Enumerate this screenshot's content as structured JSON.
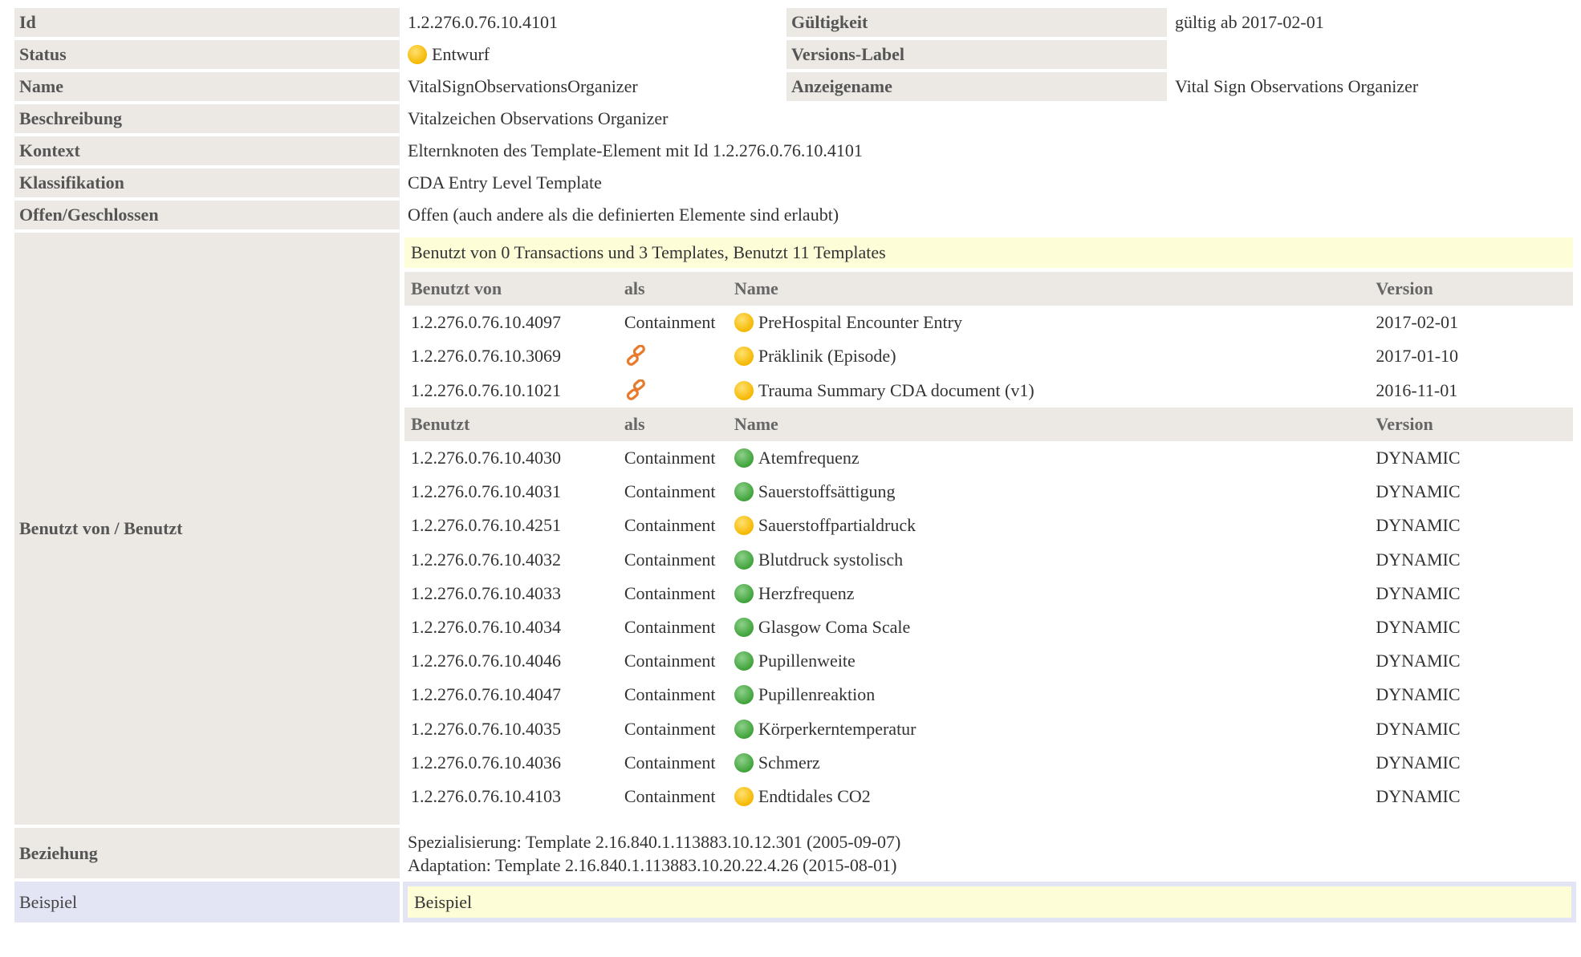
{
  "rows": {
    "id": {
      "label": "Id",
      "value": "1.2.276.0.76.10.4101"
    },
    "gueltigkeit": {
      "label": "Gültigkeit",
      "value": "gültig ab 2017-02-01"
    },
    "status": {
      "label": "Status",
      "value": "Entwurf",
      "icon": "status-draft-icon"
    },
    "version_label": {
      "label": "Versions-Label",
      "value": ""
    },
    "name": {
      "label": "Name",
      "value": "VitalSignObservationsOrganizer"
    },
    "anzeigename": {
      "label": "Anzeigename",
      "value": "Vital Sign Observations Organizer"
    },
    "beschreibung": {
      "label": "Beschreibung",
      "value": "Vitalzeichen Observations Organizer"
    },
    "kontext": {
      "label": "Kontext",
      "value": "Elternknoten des Template-Element mit Id 1.2.276.0.76.10.4101"
    },
    "klassifikation": {
      "label": "Klassifikation",
      "value": "CDA Entry Level Template"
    },
    "offen": {
      "label": "Offen/Geschlossen",
      "value": "Offen (auch andere als die definierten Elemente sind erlaubt)"
    },
    "benutzt_von_benutzt": {
      "label": "Benutzt von / Benutzt"
    },
    "beziehung": {
      "label": "Beziehung",
      "line1": "Spezialisierung: Template 2.16.840.1.113883.10.12.301 (2005-09-07)",
      "line2": "Adaptation: Template 2.16.840.1.113883.10.20.22.4.26 (2015-08-01)"
    },
    "beispiel": {
      "label": "Beispiel",
      "value": "Beispiel"
    }
  },
  "usage": {
    "summary": "Benutzt von 0 Transactions und 3 Templates, Benutzt 11 Templates",
    "used_by_header": {
      "col1": "Benutzt von",
      "col2": "als",
      "col3": "Name",
      "col4": "Version"
    },
    "used_by": [
      {
        "id": "1.2.276.0.76.10.4097",
        "as": "Containment",
        "as_icon": "",
        "name": "PreHospital Encounter Entry",
        "status": "yellow",
        "version": "2017-02-01"
      },
      {
        "id": "1.2.276.0.76.10.3069",
        "as": "",
        "as_icon": "link-icon",
        "name": "Präklinik (Episode)",
        "status": "yellow",
        "version": "2017-01-10"
      },
      {
        "id": "1.2.276.0.76.10.1021",
        "as": "",
        "as_icon": "link-icon",
        "name": "Trauma Summary CDA document (v1)",
        "status": "yellow",
        "version": "2016-11-01"
      }
    ],
    "uses_header": {
      "col1": "Benutzt",
      "col2": "als",
      "col3": "Name",
      "col4": "Version"
    },
    "uses": [
      {
        "id": "1.2.276.0.76.10.4030",
        "as": "Containment",
        "name": "Atemfrequenz",
        "status": "green",
        "version": "DYNAMIC"
      },
      {
        "id": "1.2.276.0.76.10.4031",
        "as": "Containment",
        "name": "Sauerstoffsättigung",
        "status": "green",
        "version": "DYNAMIC"
      },
      {
        "id": "1.2.276.0.76.10.4251",
        "as": "Containment",
        "name": "Sauerstoffpartialdruck",
        "status": "yellow",
        "version": "DYNAMIC"
      },
      {
        "id": "1.2.276.0.76.10.4032",
        "as": "Containment",
        "name": "Blutdruck systolisch",
        "status": "green",
        "version": "DYNAMIC"
      },
      {
        "id": "1.2.276.0.76.10.4033",
        "as": "Containment",
        "name": "Herzfrequenz",
        "status": "green",
        "version": "DYNAMIC"
      },
      {
        "id": "1.2.276.0.76.10.4034",
        "as": "Containment",
        "name": "Glasgow Coma Scale",
        "status": "green",
        "version": "DYNAMIC"
      },
      {
        "id": "1.2.276.0.76.10.4046",
        "as": "Containment",
        "name": "Pupillenweite",
        "status": "green",
        "version": "DYNAMIC"
      },
      {
        "id": "1.2.276.0.76.10.4047",
        "as": "Containment",
        "name": "Pupillenreaktion",
        "status": "green",
        "version": "DYNAMIC"
      },
      {
        "id": "1.2.276.0.76.10.4035",
        "as": "Containment",
        "name": "Körperkerntemperatur",
        "status": "green",
        "version": "DYNAMIC"
      },
      {
        "id": "1.2.276.0.76.10.4036",
        "as": "Containment",
        "name": "Schmerz",
        "status": "green",
        "version": "DYNAMIC"
      },
      {
        "id": "1.2.276.0.76.10.4103",
        "as": "Containment",
        "name": "Endtidales CO2",
        "status": "yellow",
        "version": "DYNAMIC"
      }
    ]
  },
  "colors": {
    "label_bg": "#ece9e4",
    "highlight_bg": "#fdfdd8",
    "example_bg": "#e3e5f5",
    "status_yellow": "#f5b800",
    "status_green": "#3fa33a",
    "link_orange": "#e87a2c"
  }
}
